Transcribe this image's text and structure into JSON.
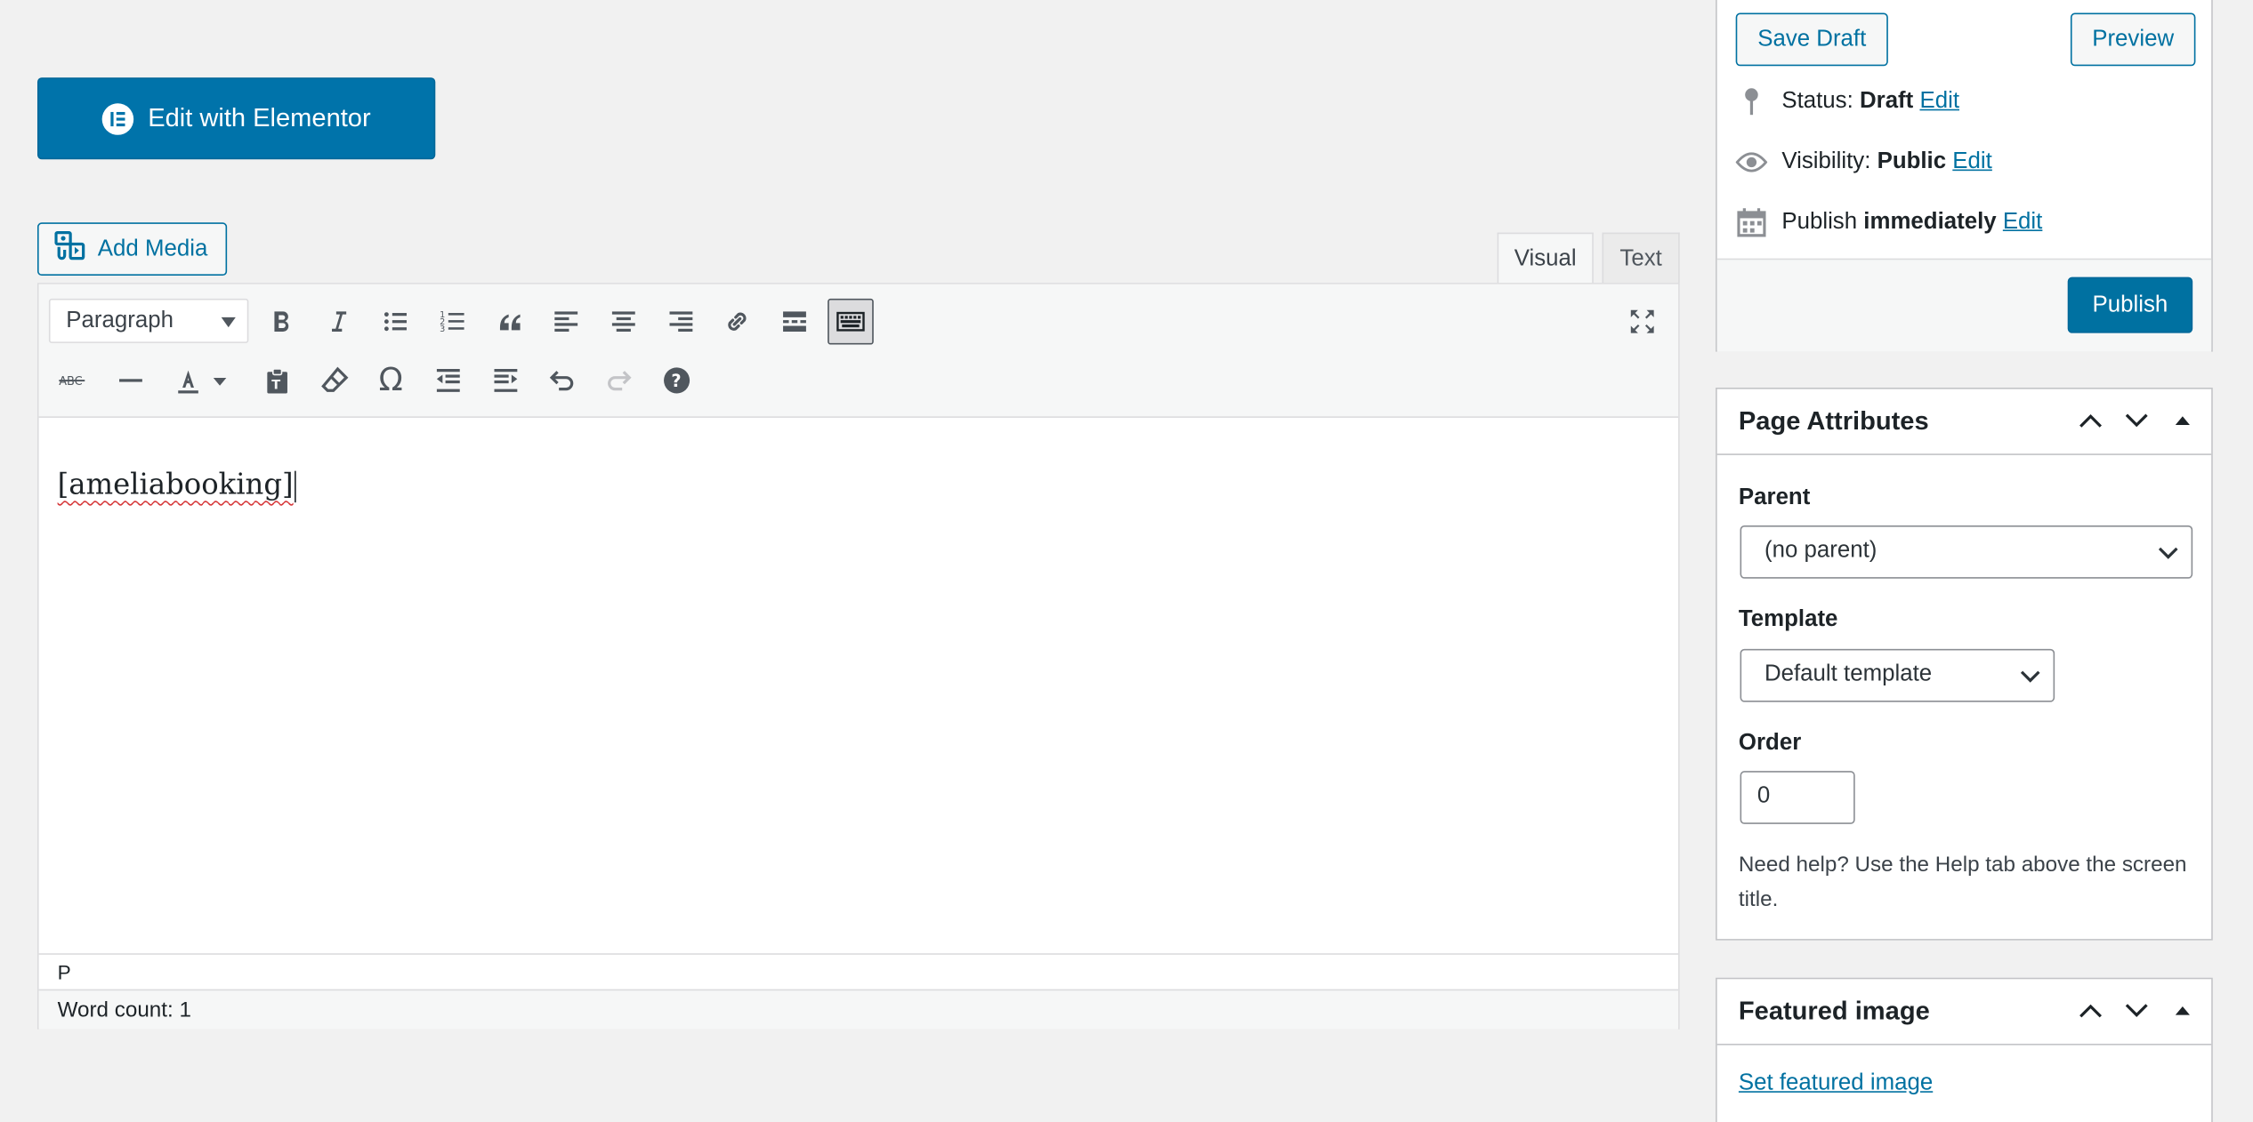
{
  "elementor": {
    "label": "Edit with Elementor"
  },
  "media": {
    "label": "Add Media"
  },
  "editor": {
    "tabs": {
      "visual": "Visual",
      "text": "Text"
    },
    "format": "Paragraph",
    "content": "[ameliabooking]",
    "path": "P",
    "word_count": "Word count: 1"
  },
  "publish": {
    "save_draft": "Save Draft",
    "preview": "Preview",
    "status_label": "Status:",
    "status_value": "Draft",
    "visibility_label": "Visibility:",
    "visibility_value": "Public",
    "publish_label": "Publish",
    "publish_value": "immediately",
    "edit": "Edit",
    "publish_button": "Publish"
  },
  "page_attributes": {
    "title": "Page Attributes",
    "parent_label": "Parent",
    "parent_value": "(no parent)",
    "template_label": "Template",
    "template_value": "Default template",
    "order_label": "Order",
    "order_value": "0",
    "help": "Need help? Use the Help tab above the screen title."
  },
  "featured": {
    "title": "Featured image",
    "link": "Set featured image"
  },
  "colors": {
    "primary": "#0071a1",
    "elementor": "#0073aa"
  }
}
